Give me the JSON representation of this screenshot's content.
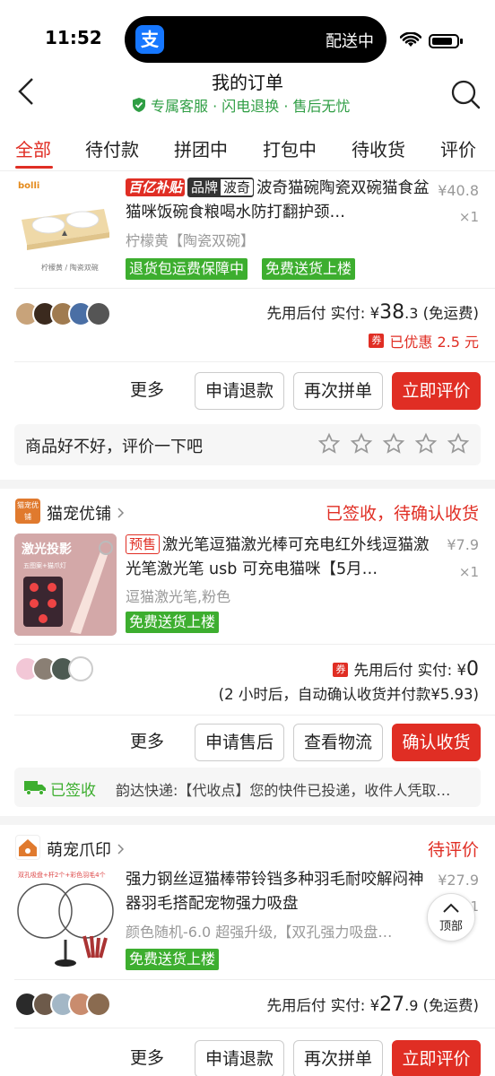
{
  "status_bar": {
    "time": "11:52",
    "island_app": "支",
    "island_text": "配送中"
  },
  "header": {
    "title": "我的订单",
    "subtitle": "专属客服 · 闪电退换 · 售后无忧"
  },
  "tabs": [
    "全部",
    "待付款",
    "拼团中",
    "打包中",
    "待收货",
    "评价"
  ],
  "orders": [
    {
      "badge_red": "百亿补贴",
      "badge_brand_a": "品牌",
      "badge_brand_b": "波奇",
      "title": "波奇猫碗陶瓷双碗猫食盆猫咪饭碗食粮喝水防打翻护颈…",
      "variant": "柠檬黄【陶瓷双碗】",
      "price": "¥40.8",
      "qty": "×1",
      "tags": [
        "退货包运费保障中",
        "免费送货上楼"
      ],
      "thumb_brand": "bolli",
      "thumb_caption": "柠檬黄 / 陶瓷双碗",
      "pay_label": "先用后付 实付: ",
      "pay_currency": "¥",
      "pay_int": "38",
      "pay_dec": ".3",
      "pay_note": " (免运费)",
      "coupon_tag": "券",
      "coupon_text": "已优惠 2.5 元",
      "buttons": [
        "更多",
        "申请退款",
        "再次拼单",
        "立即评价"
      ],
      "rate_prompt": "商品好不好，评价一下吧"
    },
    {
      "shop": "猫宠优铺",
      "shop_icon_text": "猫宠优铺",
      "status": "已签收，待确认收货",
      "badge_outline": "预售",
      "title": "激光笔逗猫激光棒可充电红外线逗猫激光笔激光笔 usb 可充电猫咪【5月…",
      "variant": "逗猫激光笔,粉色",
      "price": "¥7.9",
      "qty": "×1",
      "tags": [
        "免费送货上楼"
      ],
      "thumb_title": "激光投影",
      "thumb_sub": "五图案+猫爪灯",
      "coupon_tag": "券",
      "pay_label": "先用后付 实付: ",
      "pay_currency": "¥",
      "pay_int": "0",
      "pay_note2": "(2 小时后，自动确认收货并付款¥5.93)",
      "buttons": [
        "更多",
        "申请售后",
        "查看物流",
        "确认收货"
      ],
      "logistics_status": "已签收",
      "logistics_msg": "韵达快递:【代收点】您的快件已投递，收件人凭取…"
    },
    {
      "shop": "萌宠爪印",
      "status": "待评价",
      "title": "强力钢丝逗猫棒带铃铛多种羽毛耐咬解闷神器羽毛搭配宠物强力吸盘",
      "variant": "颜色随机-6.0 超强升级,【双孔强力吸盘…",
      "price": "¥27.9",
      "qty": "×1",
      "tags": [
        "免费送货上楼"
      ],
      "thumb_caption": "双孔吸盘+杆2个+彩色羽毛4个",
      "pay_label": "先用后付 实付: ",
      "pay_currency": "¥",
      "pay_int": "27",
      "pay_dec": ".9",
      "pay_note": " (免运费)",
      "buttons": [
        "更多",
        "申请退款",
        "再次拼单",
        "立即评价"
      ]
    }
  ],
  "float_top_label": "顶部",
  "colors": {
    "accent": "#e02e24",
    "green": "#3dae2f",
    "brand_blue": "#1677ff"
  }
}
